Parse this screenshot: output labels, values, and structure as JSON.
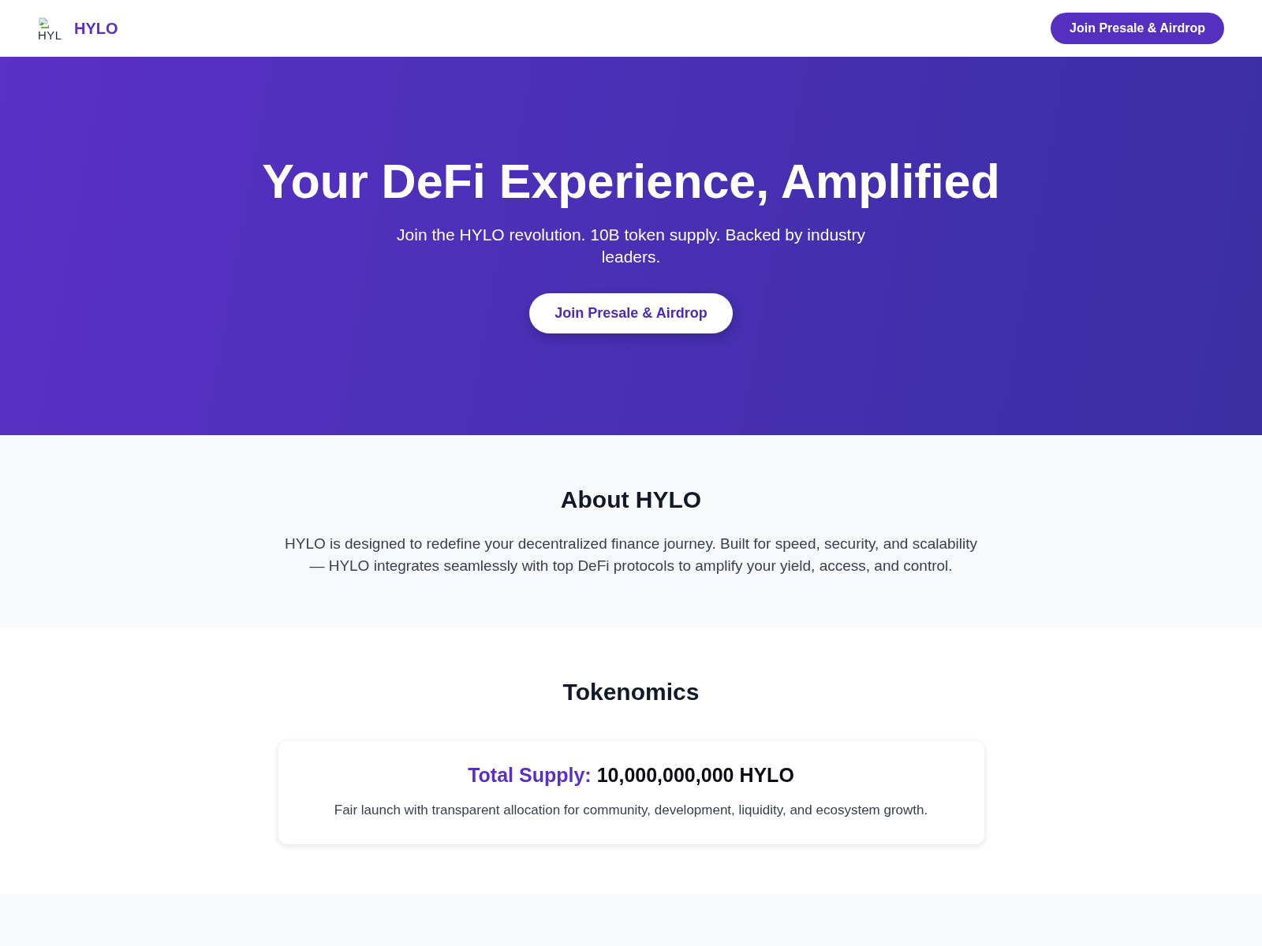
{
  "header": {
    "logo_alt": "HYL",
    "brand": "HYLO",
    "cta": "Join Presale & Airdrop"
  },
  "hero": {
    "title": "Your DeFi Experience, Amplified",
    "subtitle": "Join the HYLO revolution. 10B token supply. Backed by industry leaders.",
    "cta": "Join Presale & Airdrop"
  },
  "about": {
    "title": "About HYLO",
    "text": "HYLO is designed to redefine your decentralized finance journey. Built for speed, security, and scalability — HYLO integrates seamlessly with top DeFi protocols to amplify your yield, access, and control."
  },
  "tokenomics": {
    "title": "Tokenomics",
    "card": {
      "label": "Total Supply:",
      "value": "10,000,000,000 HYLO",
      "description": "Fair launch with transparent allocation for community, development, liquidity, and ecosystem growth."
    }
  }
}
